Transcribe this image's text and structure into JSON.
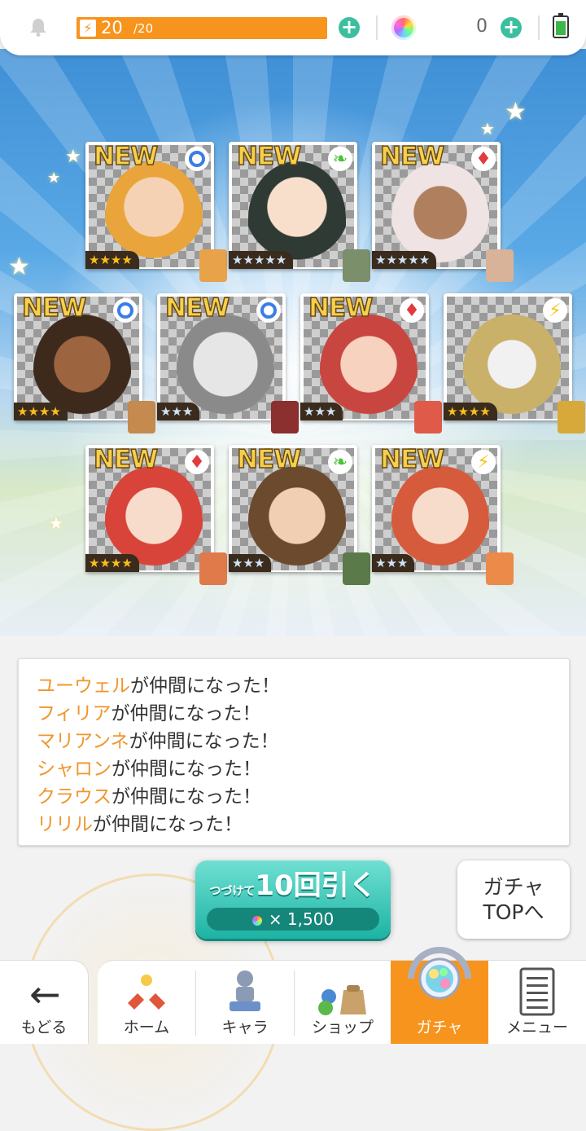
{
  "topbar": {
    "stamina_current": "20",
    "stamina_max": "/20",
    "stamina_fraction": 1.0,
    "gem_count": "0",
    "icons": [
      "bell-icon",
      "lightning-icon",
      "plus-icon",
      "rainbow-gem-icon",
      "battery-icon"
    ]
  },
  "results": {
    "new_badge": "NEW",
    "cards": [
      {
        "badge": "NEW",
        "element": "circle",
        "stars": "★★★★"
      },
      {
        "badge": "NEW",
        "element": "leaf",
        "stars": "★★★★★"
      },
      {
        "badge": "NEW",
        "element": "diamond",
        "stars": "★★★★★"
      },
      {
        "badge": "NEW",
        "element": "circle",
        "stars": "★★★★"
      },
      {
        "badge": "NEW",
        "element": "circle",
        "stars": "★★★"
      },
      {
        "badge": "NEW",
        "element": "diamond",
        "stars": "★★★"
      },
      {
        "badge": "",
        "element": "lightning",
        "stars": "★★★★"
      },
      {
        "badge": "NEW",
        "element": "diamond",
        "stars": "★★★★"
      },
      {
        "badge": "NEW",
        "element": "leaf",
        "stars": "★★★"
      },
      {
        "badge": "NEW",
        "element": "lightning",
        "stars": "★★★"
      }
    ]
  },
  "log": {
    "suffix": "が仲間になった！",
    "entries": [
      {
        "name": "ユーウェル",
        "text": "が仲間になった！"
      },
      {
        "name": "フィリア",
        "text": "が仲間になった！"
      },
      {
        "name": "マリアンネ",
        "text": "が仲間になった！"
      },
      {
        "name": "シャロン",
        "text": "が仲間になった！"
      },
      {
        "name": "クラウス",
        "text": "が仲間になった！"
      },
      {
        "name": "リリル",
        "text": "が仲間になった！"
      }
    ]
  },
  "actions": {
    "pull_small": "つづけて",
    "pull_main": "10回引く",
    "pull_cost": "× 1,500",
    "gacha_top_line1": "ガチャ",
    "gacha_top_line2": "TOPへ"
  },
  "nav": {
    "back": "もどる",
    "home": "ホーム",
    "chara": "キャラ",
    "shop": "ショップ",
    "gacha": "ガチャ",
    "menu": "メニュー"
  },
  "colors": {
    "accent_orange": "#f7941d",
    "teal": "#1db3a4",
    "name_orange": "#f0962c",
    "sky_blue": "#3f8fd6"
  }
}
